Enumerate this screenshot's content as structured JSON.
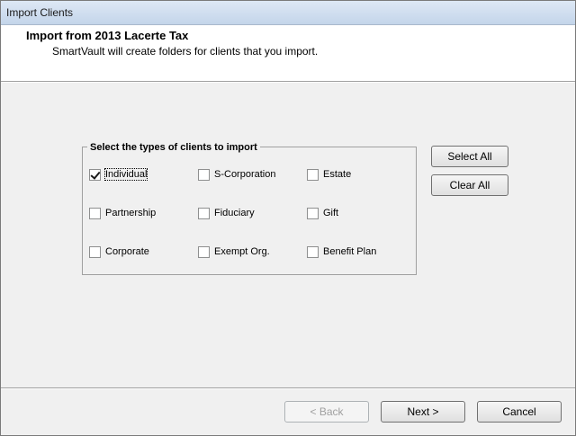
{
  "window": {
    "title": "Import Clients"
  },
  "header": {
    "title": "Import from 2013 Lacerte Tax",
    "subtitle": "SmartVault will create folders for clients that you import."
  },
  "group": {
    "legend": "Select the types of clients to import",
    "checkboxes": [
      {
        "label": "Individual",
        "checked": true
      },
      {
        "label": "S-Corporation",
        "checked": false
      },
      {
        "label": "Estate",
        "checked": false
      },
      {
        "label": "Partnership",
        "checked": false
      },
      {
        "label": "Fiduciary",
        "checked": false
      },
      {
        "label": "Gift",
        "checked": false
      },
      {
        "label": "Corporate",
        "checked": false
      },
      {
        "label": "Exempt Org.",
        "checked": false
      },
      {
        "label": "Benefit Plan",
        "checked": false
      }
    ]
  },
  "side_buttons": {
    "select_all": "Select All",
    "clear_all": "Clear All"
  },
  "footer": {
    "back": "< Back",
    "next": "Next >",
    "cancel": "Cancel",
    "back_enabled": false
  }
}
